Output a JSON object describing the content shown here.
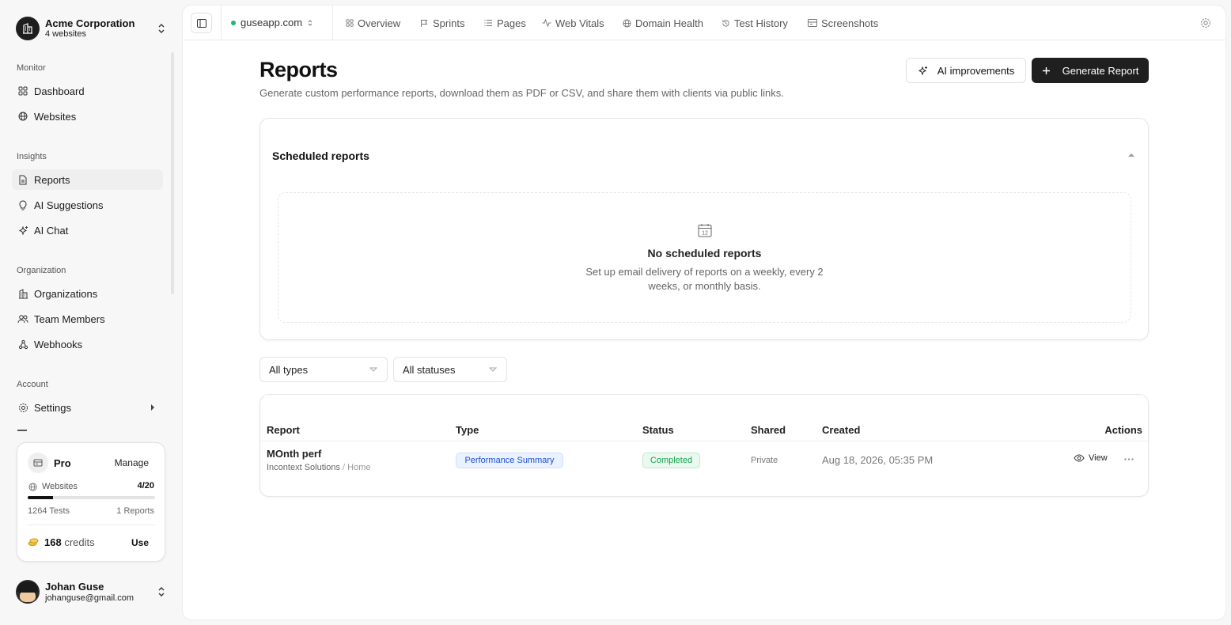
{
  "org": {
    "name": "Acme Corporation",
    "subtitle": "4 websites"
  },
  "sidebar": {
    "sections": [
      {
        "label": "Monitor"
      },
      {
        "label": "Insights"
      },
      {
        "label": "Organization"
      },
      {
        "label": "Account"
      }
    ],
    "items": [
      {
        "label": "Dashboard",
        "icon": "grid-icon"
      },
      {
        "label": "Websites",
        "icon": "globe-icon"
      },
      {
        "label": "Reports",
        "icon": "file-icon",
        "active": true
      },
      {
        "label": "AI Suggestions",
        "icon": "lightbulb-icon"
      },
      {
        "label": "AI Chat",
        "icon": "sparkles-icon"
      },
      {
        "label": "Organizations",
        "icon": "building-icon"
      },
      {
        "label": "Team Members",
        "icon": "users-icon"
      },
      {
        "label": "Webhooks",
        "icon": "webhook-icon"
      },
      {
        "label": "Settings",
        "icon": "gear-icon"
      }
    ]
  },
  "plan": {
    "name": "Pro",
    "manage_label": "Manage",
    "websites_label": "Websites",
    "websites_value": "4/20",
    "websites_progress": 0.2,
    "tests": "1264 Tests",
    "reports": "1 Reports",
    "credits_value": "168",
    "credits_label": "credits",
    "use_label": "Use"
  },
  "user": {
    "name": "Johan Guse",
    "email": "johanguse@gmail.com"
  },
  "topbar": {
    "site": "guseapp.com",
    "site_status_color": "#22b573",
    "tabs": [
      {
        "label": "Overview",
        "icon": "grid-icon"
      },
      {
        "label": "Sprints",
        "icon": "flag-icon"
      },
      {
        "label": "Pages",
        "icon": "list-icon"
      },
      {
        "label": "Web Vitals",
        "icon": "activity-icon"
      },
      {
        "label": "Domain Health",
        "icon": "globe-icon"
      },
      {
        "label": "Test History",
        "icon": "history-icon"
      },
      {
        "label": "Screenshots",
        "icon": "image-icon"
      }
    ]
  },
  "page": {
    "title": "Reports",
    "subtitle": "Generate custom performance reports, download them as PDF or CSV, and share them with clients via public links.",
    "ai_button": "AI improvements",
    "generate_button": "Generate Report"
  },
  "scheduled": {
    "title": "Scheduled reports",
    "calendar_day": "12",
    "empty_title": "No scheduled reports",
    "empty_line1": "Set up email delivery of reports on a weekly, every 2",
    "empty_line2": "weeks, or monthly basis."
  },
  "filters": {
    "type": "All types",
    "status": "All statuses"
  },
  "table": {
    "headers": {
      "report": "Report",
      "type": "Type",
      "status": "Status",
      "shared": "Shared",
      "created": "Created",
      "actions": "Actions"
    },
    "rows": [
      {
        "name": "MOnth perf",
        "org": "Incontext Solutions",
        "sep": "/",
        "page": "Home",
        "type": "Performance Summary",
        "status": "Completed",
        "shared": "Private",
        "created": "Aug 18, 2026, 05:35 PM",
        "view_label": "View"
      }
    ]
  },
  "colors": {
    "primary_dark": "#1f1f1f",
    "type_badge_bg": "#eaf2ff",
    "type_badge_text": "#1d4ed8",
    "status_badge_bg": "#e9f9ef",
    "status_badge_text": "#16a34a"
  }
}
